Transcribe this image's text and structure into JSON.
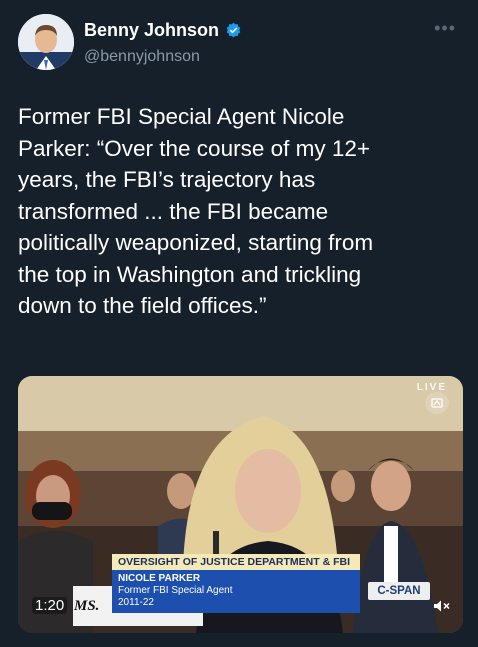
{
  "author": {
    "display_name": "Benny Johnson",
    "handle": "@bennyjohnson",
    "verified": true
  },
  "more_icon": "more-horizontal-icon",
  "tweet": {
    "text": "Former FBI Special Agent Nicole\nParker: “Over the course of my 12+\nyears, the FBI’s trajectory has\ntransformed ... the FBI became\npolitically weaponized, starting from\nthe top in Washington and trickling\ndown to the field offices.”"
  },
  "video": {
    "live_label": "LIVE",
    "lower_third_title": "OVERSIGHT OF JUSTICE DEPARTMENT & FBI",
    "speaker_name": "NICOLE PARKER",
    "speaker_role": "Former FBI Special Agent",
    "speaker_years": "2011-22",
    "placard_text": "MS.",
    "network": "C-SPAN",
    "timer": "1:20",
    "mute_icon": "speaker-muted-icon"
  },
  "colors": {
    "background": "#15202b",
    "verified_blue": "#1d9bf0",
    "handle_gray": "#8b98a5"
  }
}
